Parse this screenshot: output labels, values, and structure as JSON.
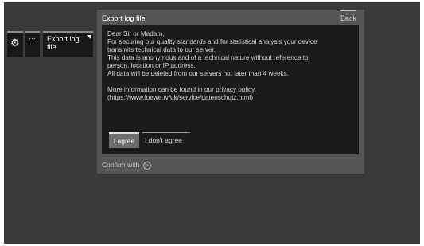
{
  "menu": {
    "gear_icon": "gear-icon",
    "dots_label": "···",
    "export_label": "Export log file"
  },
  "dialog": {
    "title": "Export log file",
    "back_label": "Back",
    "message_lines": [
      "Dear Sir or Madam,",
      "For securing our quality standards and for statistical analysis your device",
      "transmits technical data to our server.",
      "This data is anonymous and of a technical nature without reference to",
      "person, location or IP address.",
      "All data will be deleted from our servers not later than 4 weeks.",
      "",
      "More information can be found in our privacy policy.",
      "(https://www.loewe.tv/uk/service/datenschutz.html)"
    ],
    "agree_label": "I agree",
    "disagree_label": "I don't agree",
    "confirm_label": "Confirm with",
    "confirm_icon_text": "OK"
  }
}
